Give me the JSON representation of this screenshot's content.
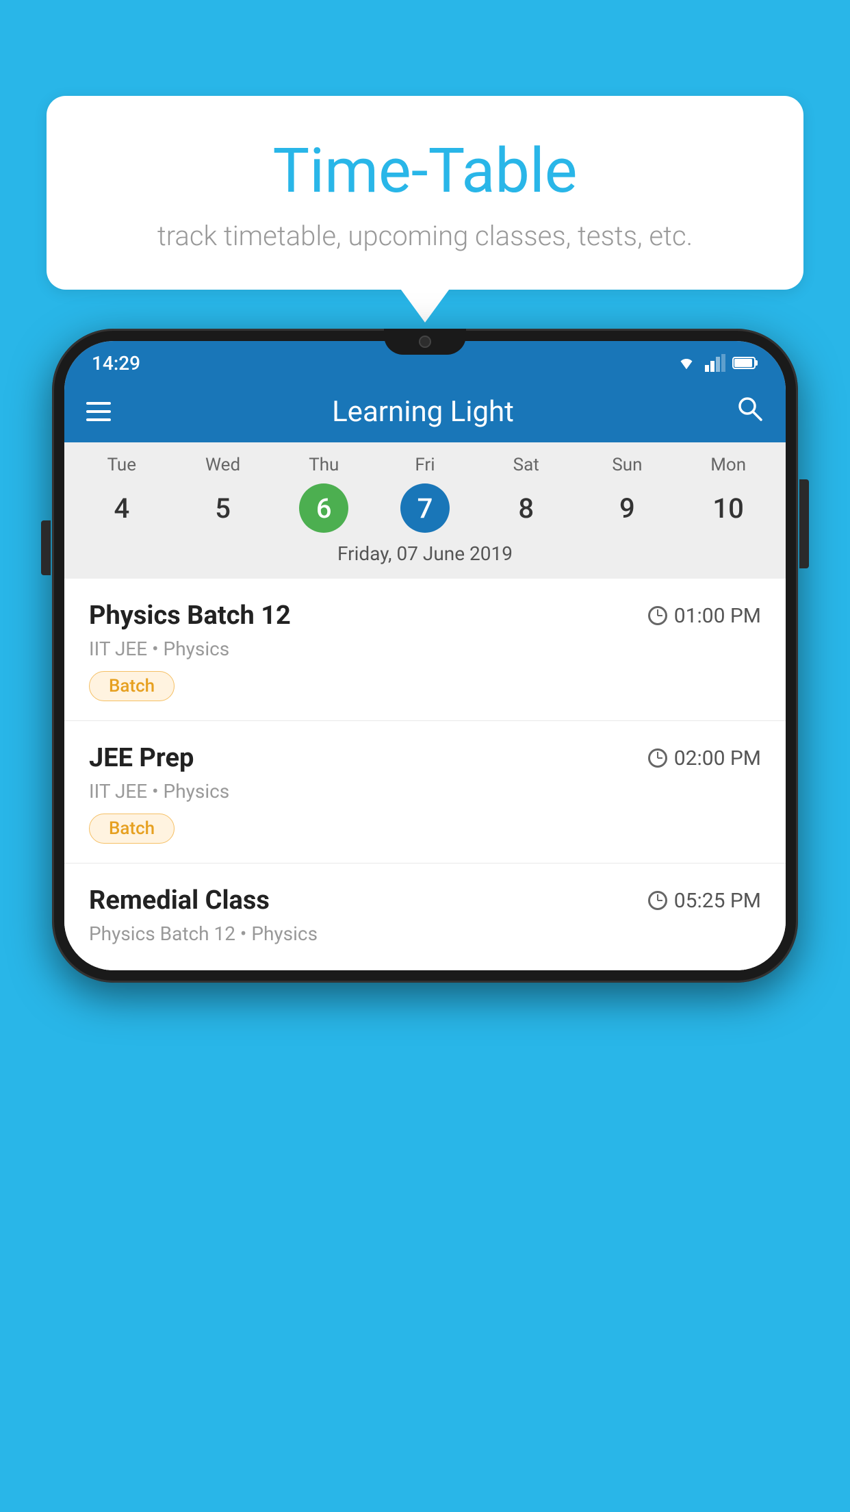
{
  "background_color": "#29B6E8",
  "speech_bubble": {
    "title": "Time-Table",
    "subtitle": "track timetable, upcoming classes, tests, etc."
  },
  "phone": {
    "status_bar": {
      "time": "14:29"
    },
    "app_bar": {
      "title": "Learning Light"
    },
    "calendar": {
      "days": [
        "Tue",
        "Wed",
        "Thu",
        "Fri",
        "Sat",
        "Sun",
        "Mon"
      ],
      "dates": [
        "4",
        "5",
        "6",
        "7",
        "8",
        "9",
        "10"
      ],
      "today_index": 2,
      "selected_index": 3,
      "selected_date_label": "Friday, 07 June 2019"
    },
    "schedule_items": [
      {
        "title": "Physics Batch 12",
        "time": "01:00 PM",
        "subtitle": "IIT JEE • Physics",
        "badge": "Batch"
      },
      {
        "title": "JEE Prep",
        "time": "02:00 PM",
        "subtitle": "IIT JEE • Physics",
        "badge": "Batch"
      },
      {
        "title": "Remedial Class",
        "time": "05:25 PM",
        "subtitle": "Physics Batch 12 • Physics",
        "badge": null
      }
    ]
  }
}
